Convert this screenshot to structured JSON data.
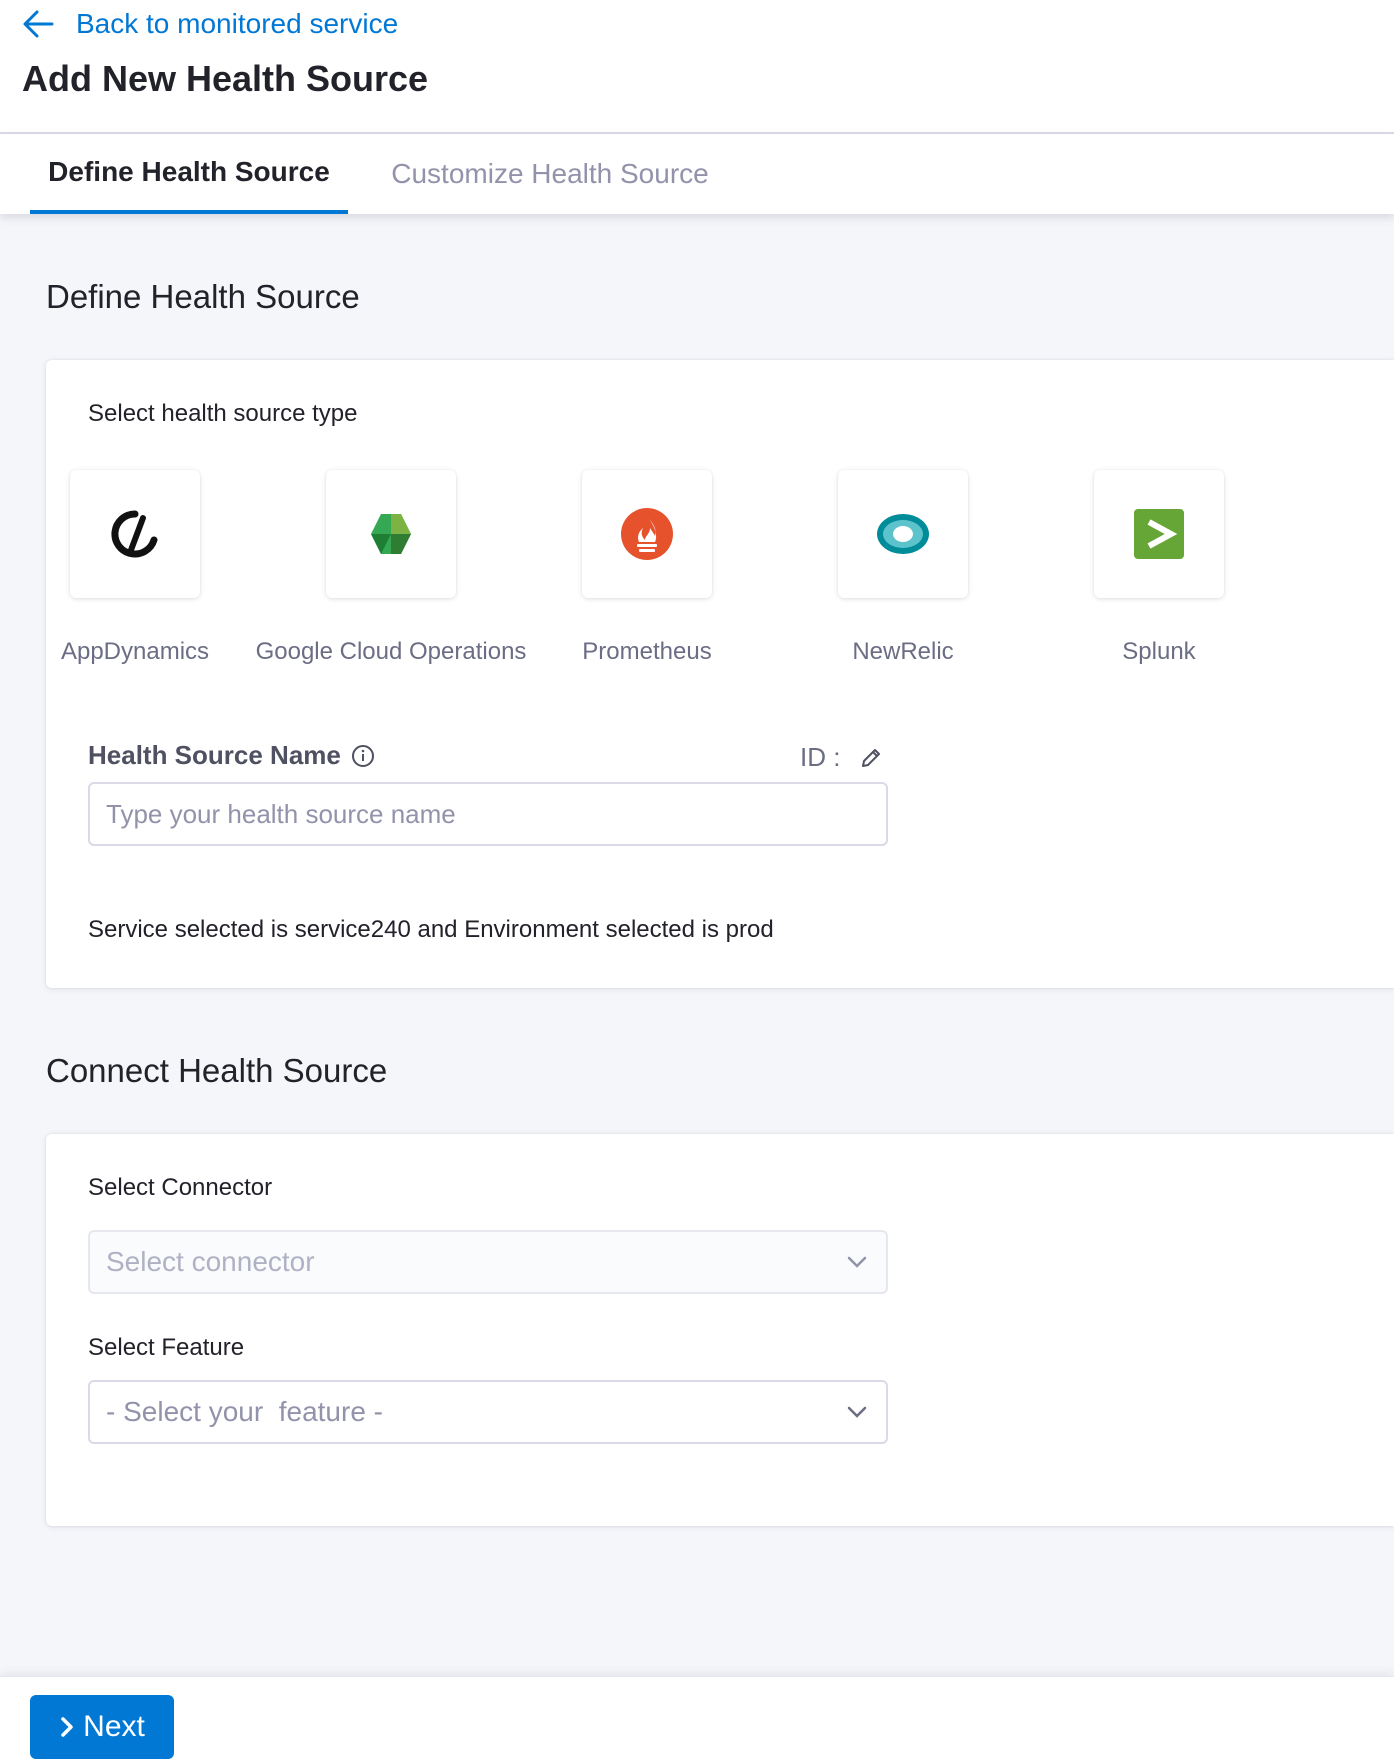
{
  "header": {
    "back_label": "Back to monitored service",
    "title": "Add New Health Source"
  },
  "tabs": [
    {
      "label": "Define Health Source",
      "active": true
    },
    {
      "label": "Customize Health Source",
      "active": false
    }
  ],
  "define_section": {
    "title": "Define Health Source",
    "select_type_label": "Select health source type",
    "sources": [
      {
        "name": "AppDynamics",
        "icon": "appdynamics-logo-icon"
      },
      {
        "name": "Google Cloud Operations",
        "icon": "google-cloud-operations-logo-icon"
      },
      {
        "name": "Prometheus",
        "icon": "prometheus-logo-icon"
      },
      {
        "name": "NewRelic",
        "icon": "newrelic-logo-icon"
      },
      {
        "name": "Splunk",
        "icon": "splunk-logo-icon"
      }
    ],
    "name_label": "Health Source Name",
    "id_label": "ID :",
    "name_placeholder": "Type your health source name",
    "name_value": "",
    "selection_info": "Service selected is service240 and Environment selected is prod"
  },
  "connect_section": {
    "title": "Connect Health Source",
    "connector_label": "Select Connector",
    "connector_placeholder": "Select connector",
    "feature_label": "Select Feature",
    "feature_placeholder": "- Select your  feature -"
  },
  "footer": {
    "next_label": "Next"
  },
  "colors": {
    "primary": "#0278d5",
    "background": "#f4f6fa",
    "prometheus": "#e6522c",
    "newrelic": "#008c99",
    "splunk": "#65a637"
  }
}
